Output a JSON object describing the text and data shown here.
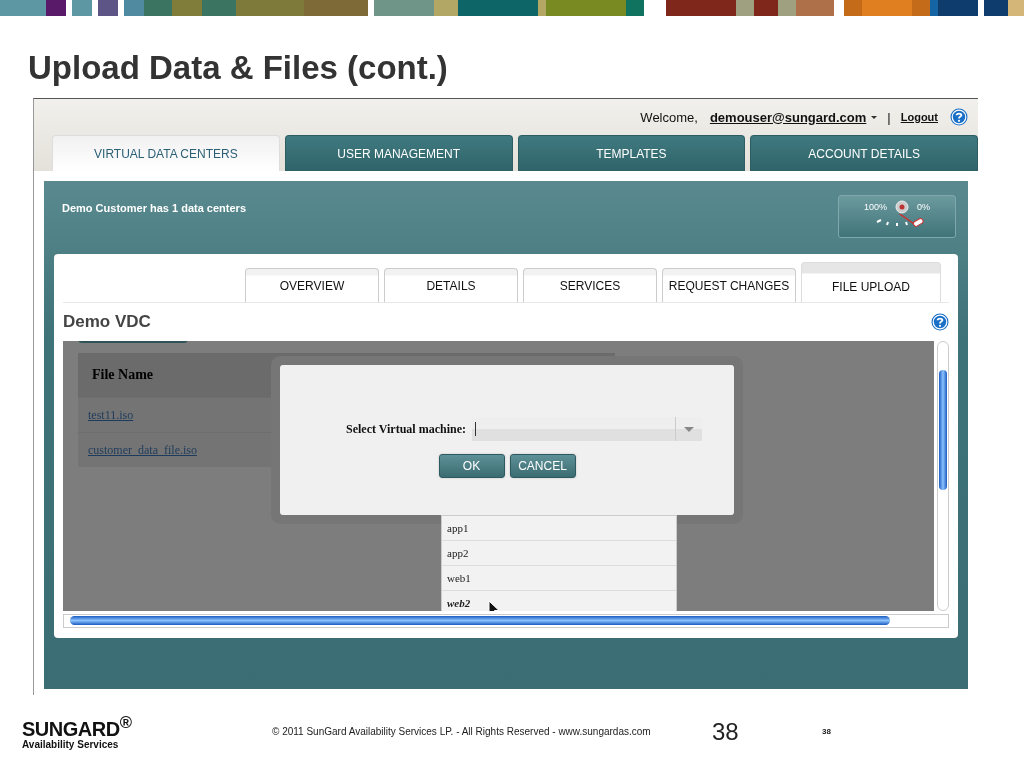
{
  "slide": {
    "title": "Upload Data & Files (cont.)"
  },
  "app": {
    "welcome": "Welcome,",
    "user": "demouser@sungard.com",
    "separator": "|",
    "logout": "Logout",
    "tabs": [
      {
        "label": "VIRTUAL DATA CENTERS",
        "selected": true
      },
      {
        "label": "USER MANAGEMENT",
        "selected": false
      },
      {
        "label": "TEMPLATES",
        "selected": false
      },
      {
        "label": "ACCOUNT DETAILS",
        "selected": false
      }
    ],
    "banner": {
      "text": "Demo Customer has 1 data centers",
      "gauge_max": "100%",
      "gauge_min": "0%"
    },
    "subtabs": [
      {
        "label": "OVERVIEW",
        "selected": false
      },
      {
        "label": "DETAILS",
        "selected": false
      },
      {
        "label": "SERVICES",
        "selected": false
      },
      {
        "label": "REQUEST CHANGES",
        "selected": false
      },
      {
        "label": "FILE UPLOAD",
        "selected": true
      }
    ],
    "page_title": "Demo VDC",
    "table": {
      "columns": [
        "File Name"
      ],
      "rows": [
        [
          "test11.iso"
        ],
        [
          "customer_data_file.iso"
        ]
      ]
    },
    "dialog": {
      "label": "Select Virtual machine:",
      "buttons": [
        "OK",
        "CANCEL"
      ],
      "options": [
        {
          "label": "app1",
          "selected": false
        },
        {
          "label": "app2",
          "selected": false
        },
        {
          "label": "web1",
          "selected": false
        },
        {
          "label": "web2",
          "selected": true
        }
      ]
    }
  },
  "footer": {
    "logo": "SUNGARD",
    "logo_mark": "®",
    "logo_sub": "Availability Services",
    "copyright": "© 2011 SunGard Availability Services LP. - All Rights Reserved - www.sungardas.com",
    "page_number": "38",
    "page_number_small": "38"
  }
}
